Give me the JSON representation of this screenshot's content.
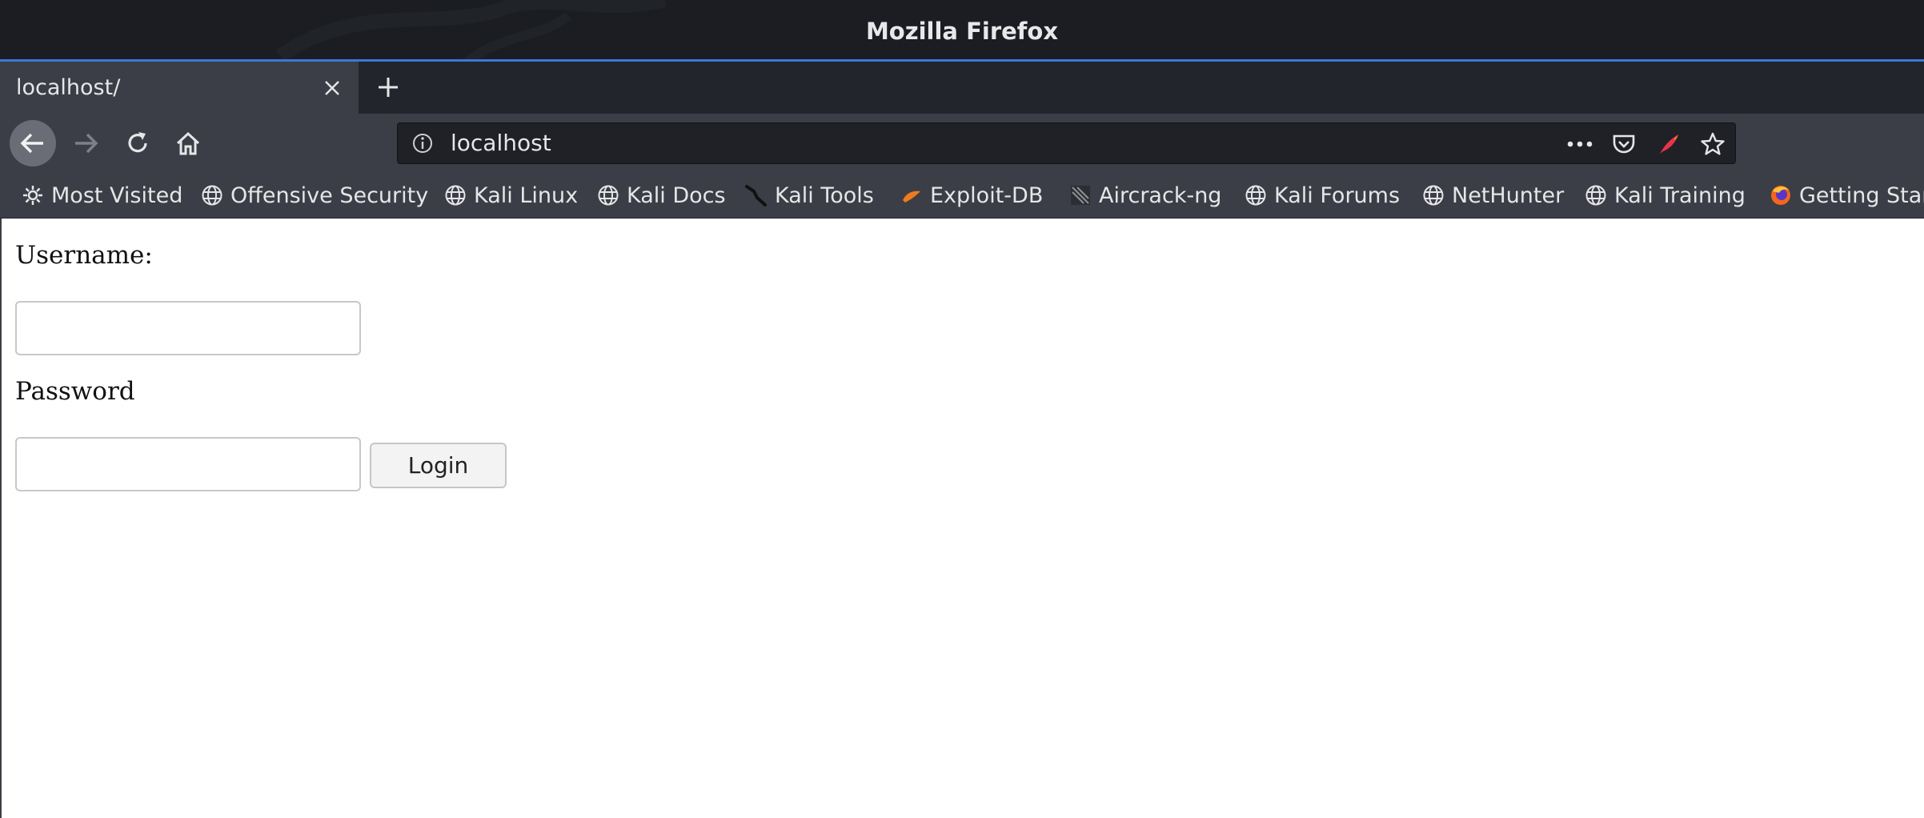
{
  "window": {
    "title": "Mozilla Firefox"
  },
  "tab": {
    "title": "localhost/",
    "close_icon": "close-icon",
    "new_tab_icon": "plus-icon"
  },
  "nav": {
    "url": "localhost",
    "buttons": [
      "back-arrow-icon",
      "forward-arrow-icon",
      "reload-icon",
      "home-icon"
    ],
    "url_actions": [
      "more-icon",
      "pocket-icon",
      "feather-icon",
      "star-icon"
    ]
  },
  "bookmarks": [
    {
      "label": "Most Visited",
      "icon": "gear-icon"
    },
    {
      "label": "Offensive Security",
      "icon": "globe-icon"
    },
    {
      "label": "Kali Linux",
      "icon": "globe-icon"
    },
    {
      "label": "Kali Docs",
      "icon": "globe-icon"
    },
    {
      "label": "Kali Tools",
      "icon": "kali-tools-icon"
    },
    {
      "label": "Exploit-DB",
      "icon": "exploit-db-icon"
    },
    {
      "label": "Aircrack-ng",
      "icon": "aircrack-icon"
    },
    {
      "label": "Kali Forums",
      "icon": "globe-icon"
    },
    {
      "label": "NetHunter",
      "icon": "globe-icon"
    },
    {
      "label": "Kali Training",
      "icon": "globe-icon"
    },
    {
      "label": "Getting Star",
      "icon": "firefox-icon"
    }
  ],
  "form": {
    "username_label": "Username:",
    "username_value": "",
    "password_label": "Password",
    "password_value": "",
    "login_button": "Login"
  },
  "colors": {
    "titlebar": "#1b1d22",
    "accent": "#3a78d8",
    "toolbar": "#3b3e46",
    "urlbar": "#1f2126"
  }
}
